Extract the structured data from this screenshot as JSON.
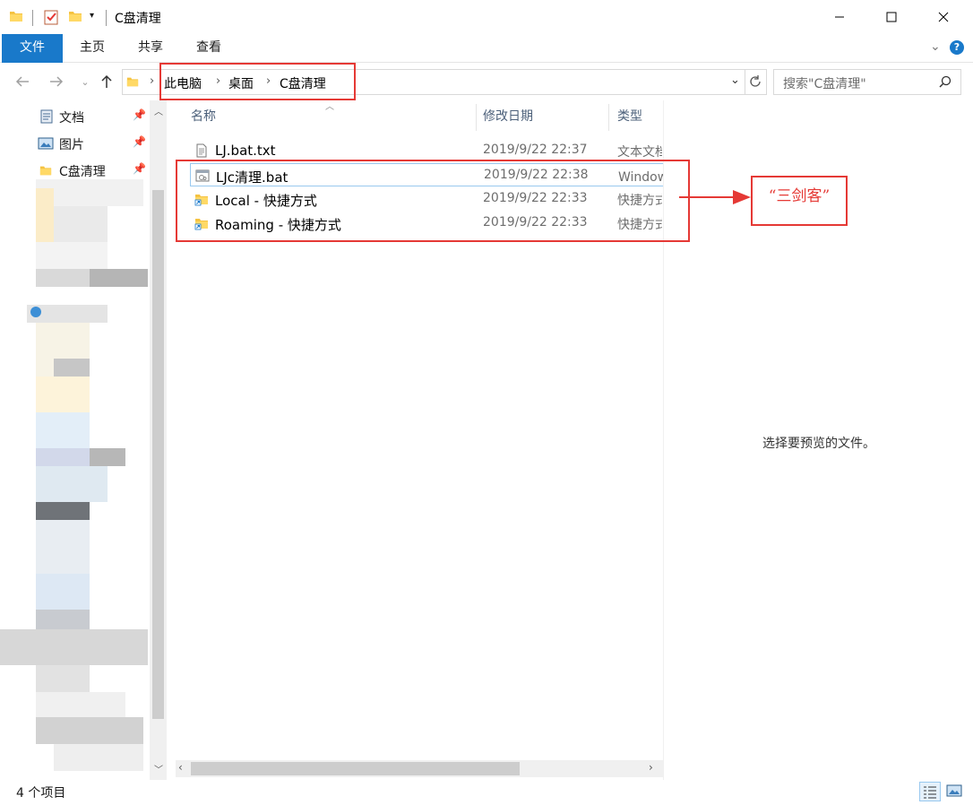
{
  "window": {
    "title": "C盘清理"
  },
  "ribbon": {
    "tabs": [
      "文件",
      "主页",
      "共享",
      "查看"
    ]
  },
  "address": {
    "crumbs": [
      "此电脑",
      "桌面",
      "C盘清理"
    ]
  },
  "search": {
    "placeholder": "搜索\"C盘清理\""
  },
  "nav": {
    "items": [
      {
        "label": "文档",
        "icon": "documents-icon"
      },
      {
        "label": "图片",
        "icon": "pictures-icon"
      },
      {
        "label": "C盘清理",
        "icon": "folder-icon"
      }
    ]
  },
  "columns": {
    "name": "名称",
    "date": "修改日期",
    "type": "类型"
  },
  "files": [
    {
      "name": "LJ.bat.txt",
      "date": "2019/9/22 22:37",
      "type": "文本文档",
      "icon": "text-file-icon"
    },
    {
      "name": "LJc清理.bat",
      "date": "2019/9/22 22:38",
      "type": "Windows 批处理文件",
      "icon": "batch-file-icon"
    },
    {
      "name": "Local - 快捷方式",
      "date": "2019/9/22 22:33",
      "type": "快捷方式",
      "icon": "folder-shortcut-icon"
    },
    {
      "name": "Roaming - 快捷方式",
      "date": "2019/9/22 22:33",
      "type": "快捷方式",
      "icon": "folder-shortcut-icon"
    }
  ],
  "preview": {
    "message": "选择要预览的文件。"
  },
  "status": {
    "count": "4 个项目"
  },
  "annotation": {
    "label": "“三剑客”",
    "color": "#e53935"
  },
  "colors": {
    "accent": "#1979ca"
  }
}
